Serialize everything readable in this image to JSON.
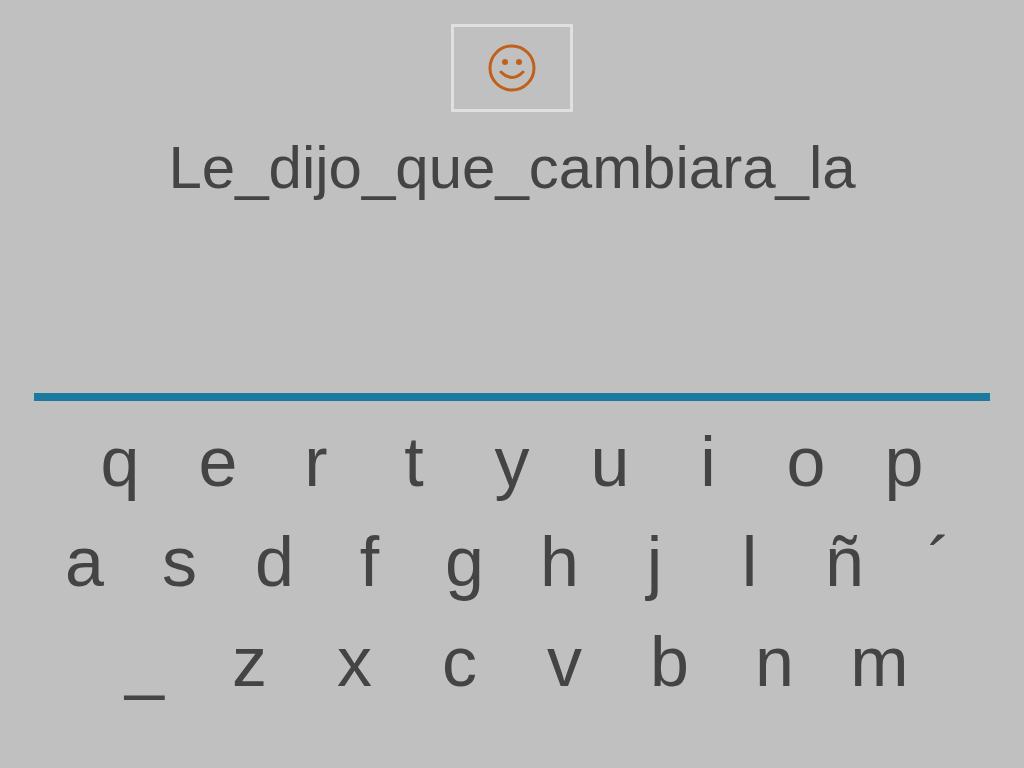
{
  "sentence": "Le_dijo_que_cambiara_la",
  "keyboard": [
    [
      "q",
      "e",
      "r",
      "t",
      "y",
      "u",
      "i",
      "o",
      "p"
    ],
    [
      "a",
      "s",
      "d",
      "f",
      "g",
      "h",
      "j",
      "l",
      "ñ",
      "´"
    ],
    [
      "_",
      "z",
      "x",
      "c",
      "v",
      "b",
      "n",
      "m"
    ]
  ]
}
